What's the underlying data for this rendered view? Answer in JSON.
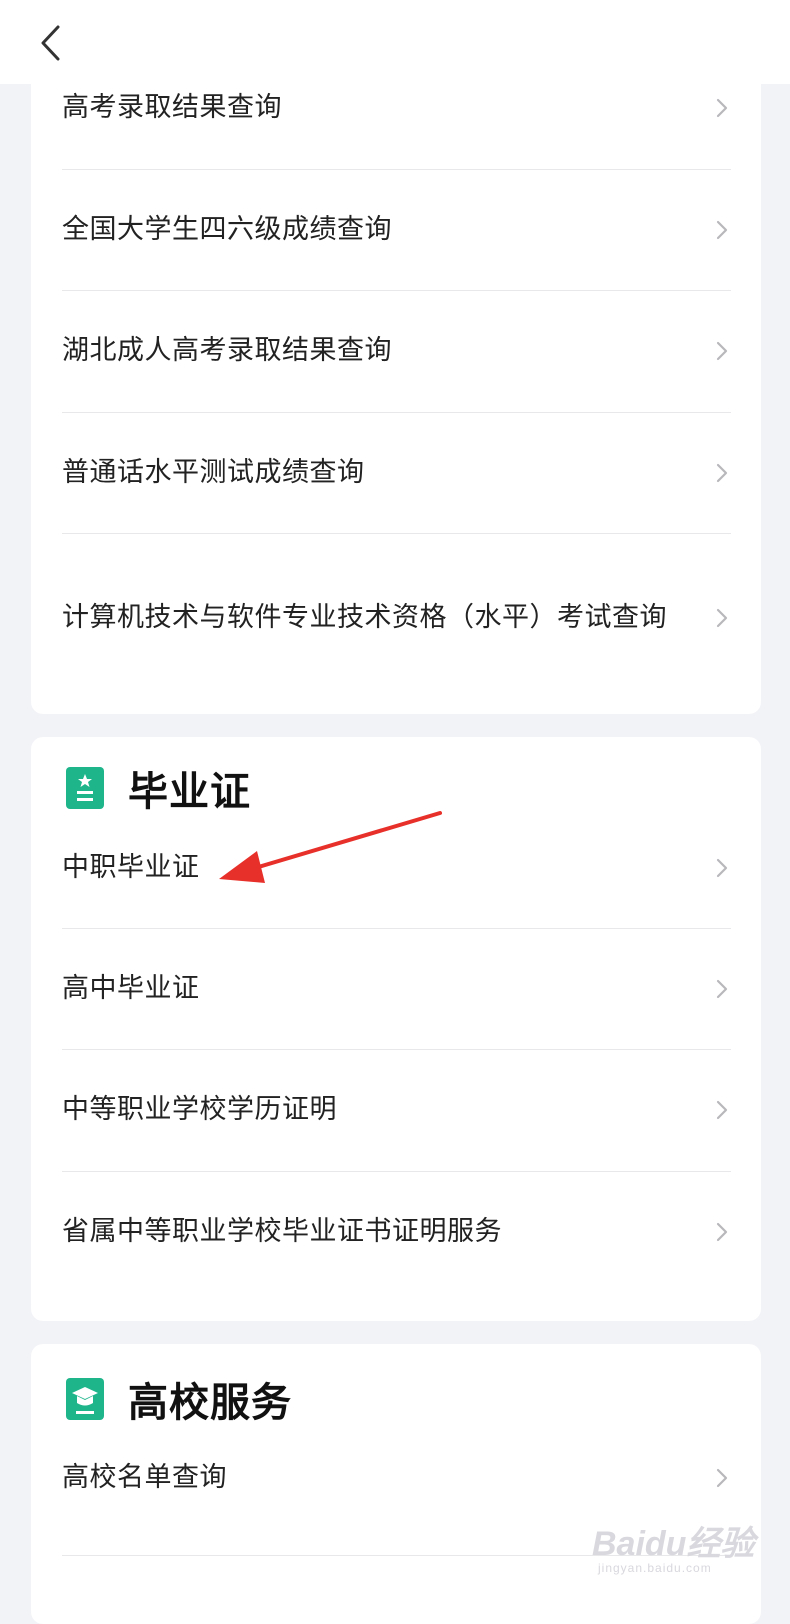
{
  "header": {
    "back_icon": "chevron-left-icon"
  },
  "section_top": {
    "items": [
      {
        "label": "高考录取结果查询"
      },
      {
        "label": "全国大学生四六级成绩查询"
      },
      {
        "label": "湖北成人高考录取结果查询"
      },
      {
        "label": "普通话水平测试成绩查询"
      },
      {
        "label": "计算机技术与软件专业技术资格（水平）考试查询"
      }
    ]
  },
  "section_graduation": {
    "title": "毕业证",
    "icon": "certificate-icon",
    "items": [
      {
        "label": "中职毕业证"
      },
      {
        "label": "高中毕业证"
      },
      {
        "label": "中等职业学校学历证明"
      },
      {
        "label": "省属中等职业学校毕业证书证明服务"
      }
    ]
  },
  "section_university": {
    "title": "高校服务",
    "icon": "graduation-cap-icon",
    "items": [
      {
        "label": "高校名单查询"
      }
    ]
  },
  "annotation": {
    "icon": "red-arrow-icon",
    "color": "#e8302a"
  },
  "colors": {
    "accent": "#1fb58b",
    "background": "#f2f3f7"
  },
  "watermark": {
    "brand": "Baidu经验",
    "url": "jingyan.baidu.com"
  }
}
